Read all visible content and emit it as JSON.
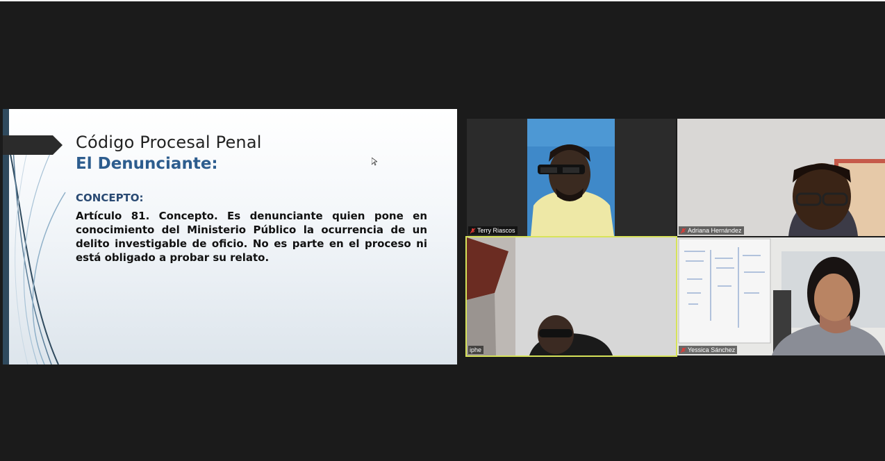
{
  "slide": {
    "title": "Código Procesal Penal",
    "subtitle": "El Denunciante:",
    "section": "CONCEPTO:",
    "body": "Artículo 81. Concepto. Es denunciante quien pone en conocimiento del Ministerio Público la ocurrencia de un delito investigable de oficio. No es parte en el proceso ni está obligado a probar su relato."
  },
  "participants": [
    {
      "name": "Terry Riascos",
      "muted": true,
      "active": false
    },
    {
      "name": "Adriana Hernández",
      "muted": true,
      "active": false
    },
    {
      "name": "iphe",
      "muted": false,
      "active": true
    },
    {
      "name": "Yessica Sánchez",
      "muted": true,
      "active": false
    }
  ],
  "colors": {
    "active_speaker_border": "#d7e35a",
    "mute_icon": "#e53935",
    "slide_accent": "#2d5d8e"
  }
}
